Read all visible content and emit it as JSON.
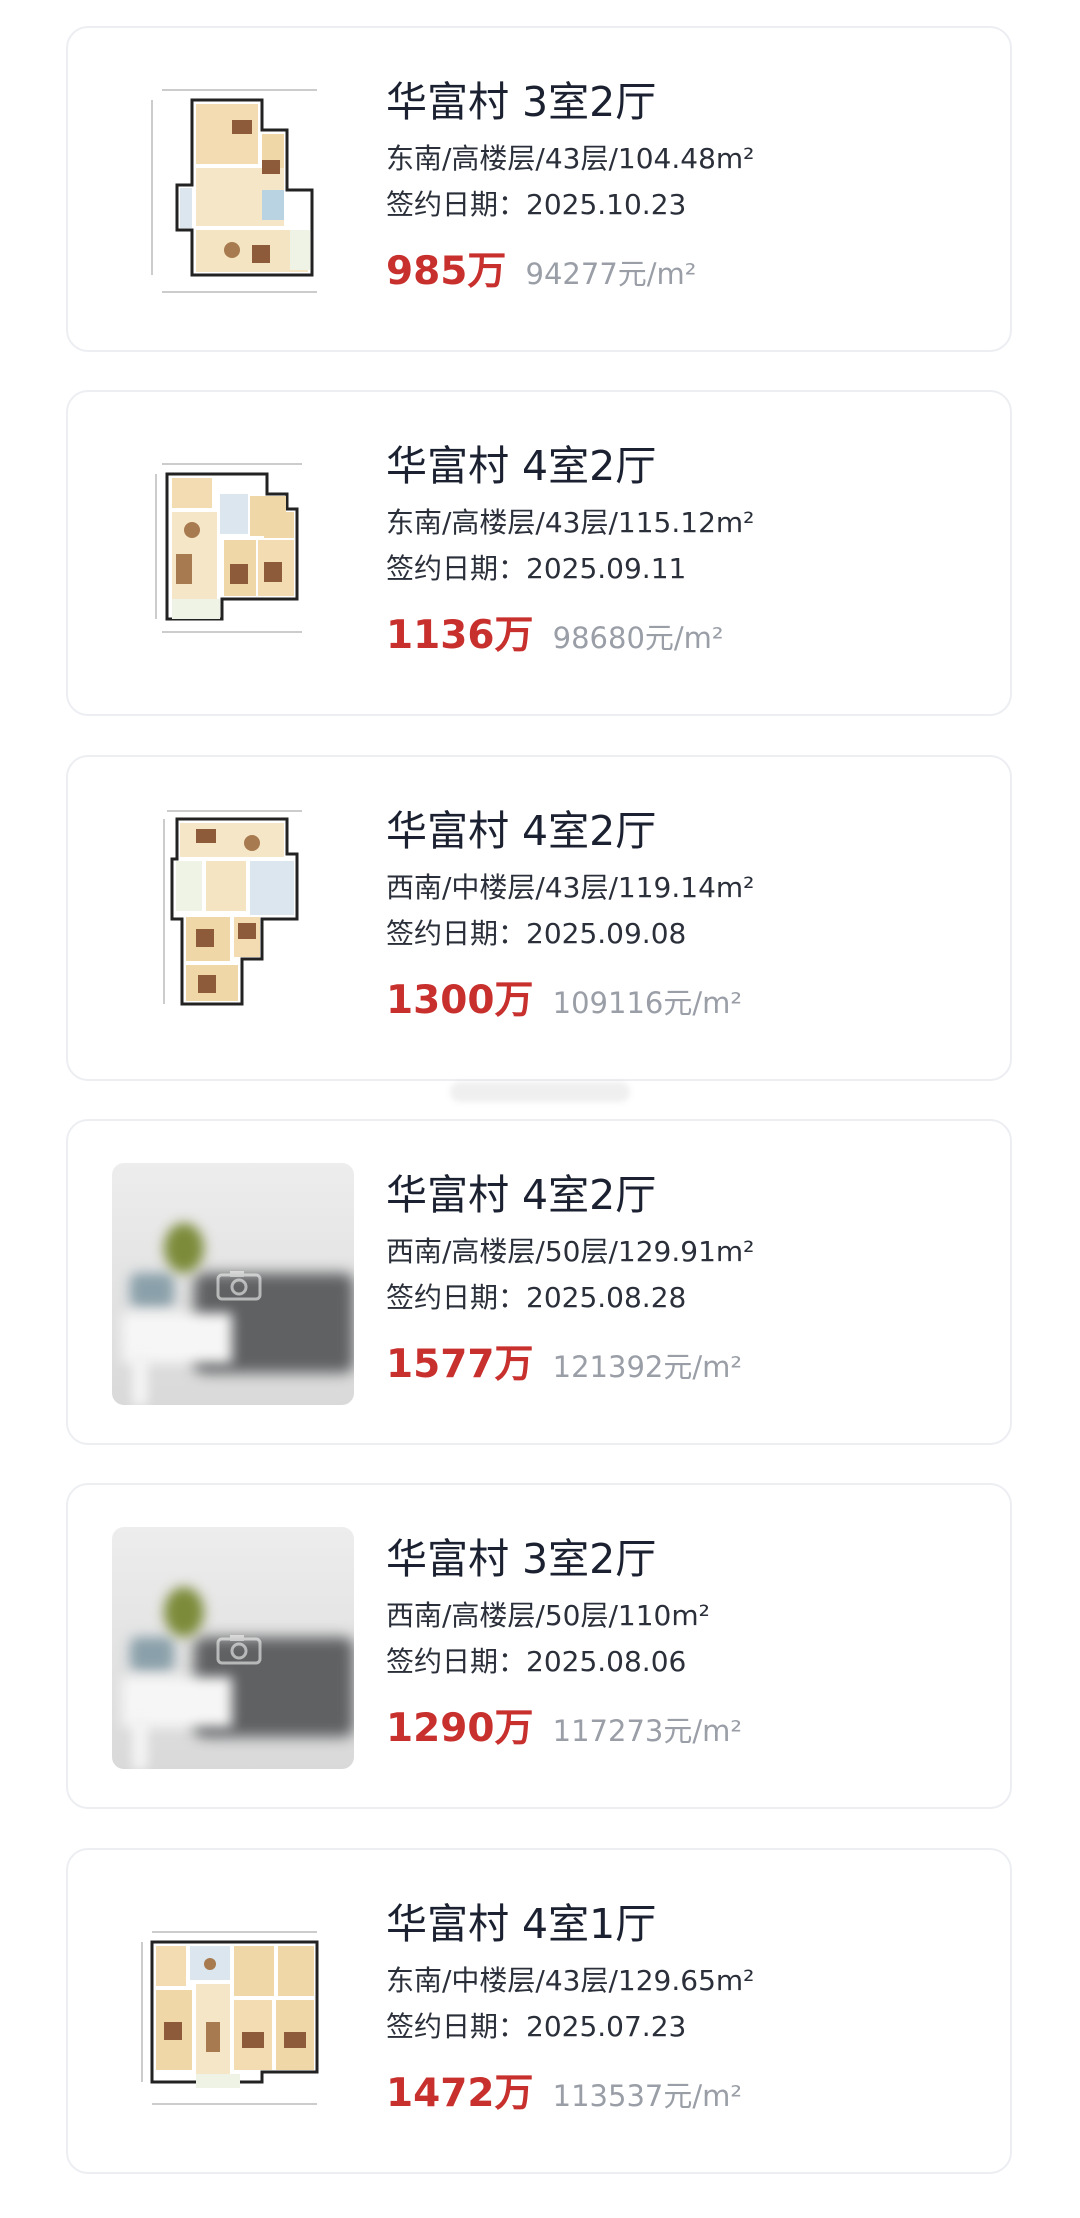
{
  "listings": [
    {
      "title": "华富村 3室2厅",
      "details": "东南/高楼层/43层/104.48m²",
      "signing_date": "签约日期：2025.10.23",
      "total_price": "985万",
      "unit_price": "94277元/m²",
      "thumbnail": "floorplan-icon"
    },
    {
      "title": "华富村 4室2厅",
      "details": "东南/高楼层/43层/115.12m²",
      "signing_date": "签约日期：2025.09.11",
      "total_price": "1136万",
      "unit_price": "98680元/m²",
      "thumbnail": "floorplan-icon"
    },
    {
      "title": "华富村 4室2厅",
      "details": "西南/中楼层/43层/119.14m²",
      "signing_date": "签约日期：2025.09.08",
      "total_price": "1300万",
      "unit_price": "109116元/m²",
      "thumbnail": "floorplan-icon"
    },
    {
      "title": "华富村 4室2厅",
      "details": "西南/高楼层/50层/129.91m²",
      "signing_date": "签约日期：2025.08.28",
      "total_price": "1577万",
      "unit_price": "121392元/m²",
      "thumbnail": "placeholder-photo"
    },
    {
      "title": "华富村 3室2厅",
      "details": "西南/高楼层/50层/110m²",
      "signing_date": "签约日期：2025.08.06",
      "total_price": "1290万",
      "unit_price": "117273元/m²",
      "thumbnail": "placeholder-photo"
    },
    {
      "title": "华富村 4室1厅",
      "details": "东南/中楼层/43层/129.65m²",
      "signing_date": "签约日期：2025.07.23",
      "total_price": "1472万",
      "unit_price": "113537元/m²",
      "thumbnail": "floorplan-icon"
    }
  ],
  "colors": {
    "price": "#c8302e",
    "title": "#1b2130",
    "muted": "#9a9ea7",
    "card_border": "#eceef2"
  }
}
